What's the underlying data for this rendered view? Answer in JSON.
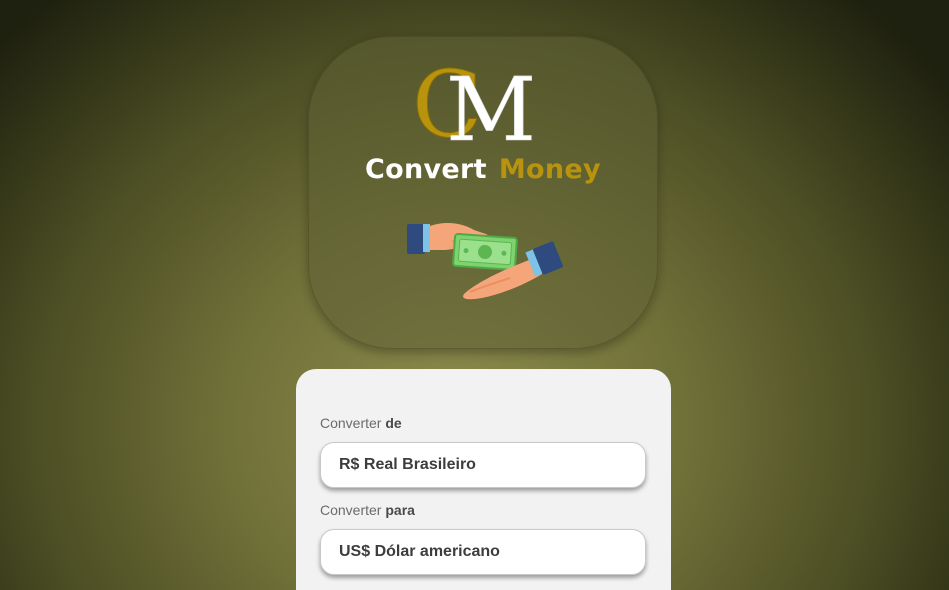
{
  "brand": {
    "monogram_letters": "CM",
    "word1": "Convert",
    "word2": "Money",
    "colors": {
      "gold": "#b8940e",
      "white": "#ffffff"
    }
  },
  "illustration": {
    "icon": "hands-exchanging-money-icon"
  },
  "form": {
    "from": {
      "label_prefix": "Converter",
      "label_strong": "de",
      "selected": "R$ Real Brasileiro"
    },
    "to": {
      "label_prefix": "Converter",
      "label_strong": "para",
      "selected": "US$ Dólar americano"
    }
  }
}
